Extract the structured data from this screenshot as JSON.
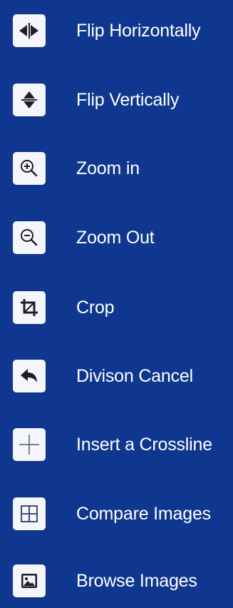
{
  "menu": {
    "items": [
      {
        "label": "Flip Horizontally",
        "icon": "flip-horizontal-icon"
      },
      {
        "label": "Flip Vertically",
        "icon": "flip-vertical-icon"
      },
      {
        "label": "Zoom in",
        "icon": "zoom-in-icon"
      },
      {
        "label": "Zoom Out",
        "icon": "zoom-out-icon"
      },
      {
        "label": "Crop",
        "icon": "crop-icon"
      },
      {
        "label": "Divison Cancel",
        "icon": "undo-arrow-icon"
      },
      {
        "label": "Insert a Crossline",
        "icon": "crossline-icon"
      },
      {
        "label": "Compare Images",
        "icon": "compare-grid-icon"
      },
      {
        "label": "Browse Images",
        "icon": "image-icon"
      }
    ]
  },
  "colors": {
    "background": "#10378f",
    "icon_bg": "#f4f6fa",
    "icon_fg": "#1d1d2b",
    "text": "#ffffff"
  }
}
